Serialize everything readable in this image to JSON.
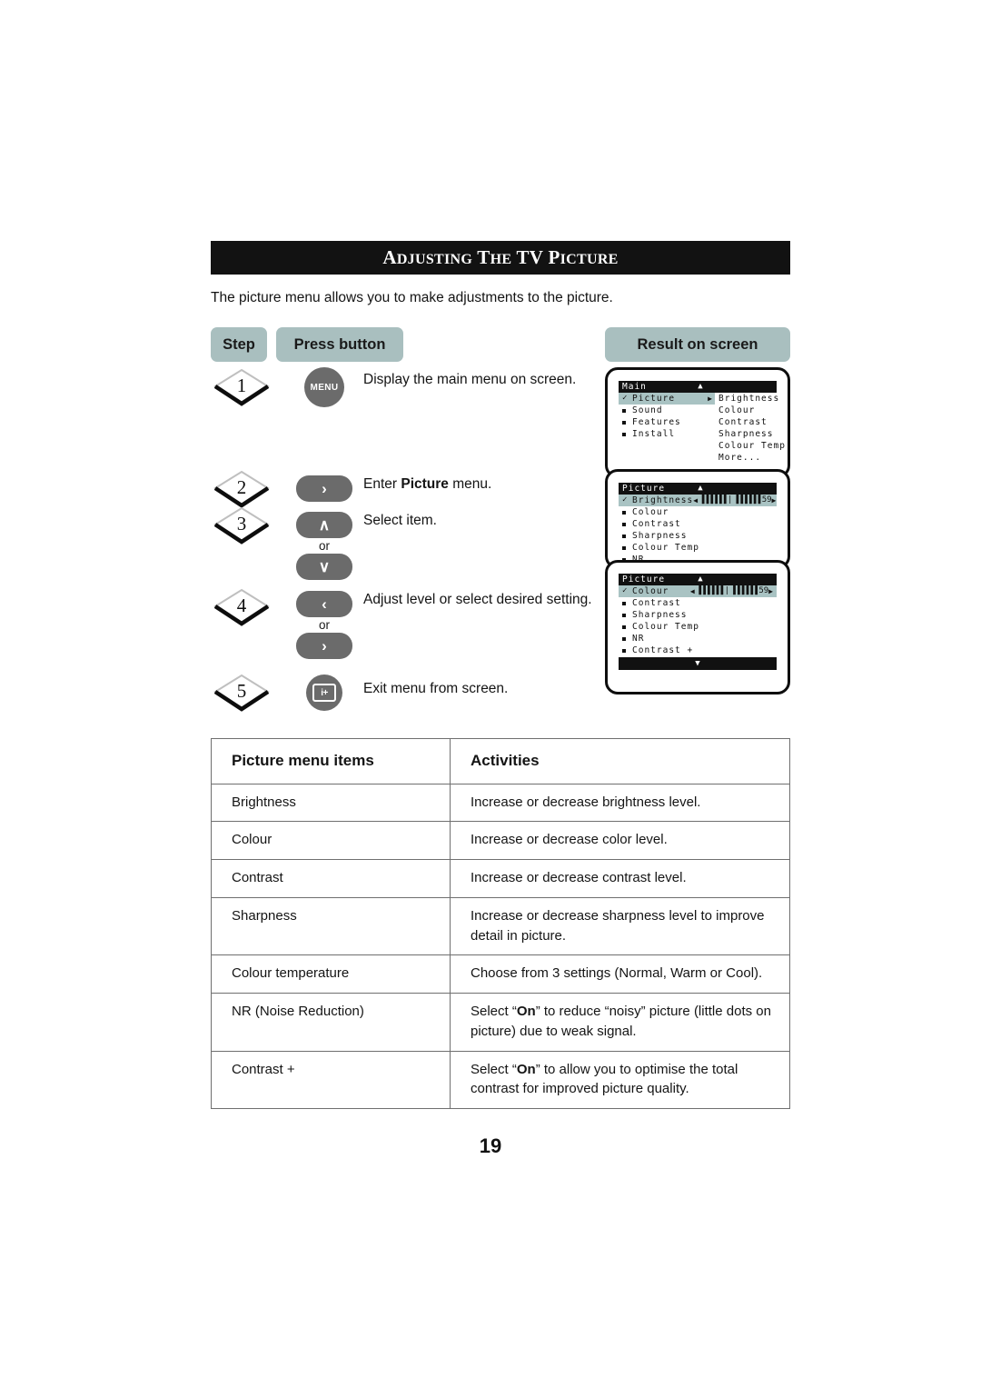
{
  "header": {
    "title_small_1": "A",
    "title": "ADJUSTING THE TV PICTURE",
    "intro": "The picture menu allows you to make adjustments to the picture."
  },
  "column_headers": {
    "step": "Step",
    "press_button": "Press button",
    "result": "Result on screen"
  },
  "steps": [
    {
      "number": "1",
      "button_kind": "circle",
      "button_label": "MENU",
      "description": "Display the main menu on screen."
    },
    {
      "number": "2",
      "button_kind": "pill",
      "button_label": "›",
      "description_prefix": "Enter ",
      "description_bold": "Picture",
      "description_suffix": " menu."
    },
    {
      "number": "3",
      "button_kind": "pill-pair",
      "button_label_top": "∧",
      "or_label": "or",
      "button_label_bottom": "∨",
      "description": "Select item."
    },
    {
      "number": "4",
      "button_kind": "pill-pair",
      "button_label_top": "‹",
      "or_label": "or",
      "button_label_bottom": "›",
      "description": "Adjust level or select desired setting."
    },
    {
      "number": "5",
      "button_kind": "circle-info",
      "button_label": "i+",
      "description": "Exit menu from screen."
    }
  ],
  "screens": [
    {
      "name": "main-menu",
      "title": "Main",
      "up_arrow": "▲",
      "left_items": [
        {
          "label": "Picture",
          "selected": true,
          "has_right_arrow": true
        },
        {
          "label": "Sound",
          "selected": false
        },
        {
          "label": "Features",
          "selected": false
        },
        {
          "label": "Install",
          "selected": false
        }
      ],
      "right_items": [
        "Brightness",
        "Colour",
        "Contrast",
        "Sharpness",
        "Colour Temp",
        "More..."
      ]
    },
    {
      "name": "picture-menu-brightness",
      "title": "Picture",
      "up_arrow": "▲",
      "items": [
        {
          "label": "Brightness",
          "selected": true,
          "slider": {
            "value": "59",
            "left_arrow": "◀",
            "right_arrow": "▶",
            "ticks_left": "▐▐▐▐▐▐",
            "center": "|",
            "ticks_right": "▐▐▐▐▐▐"
          }
        },
        {
          "label": "Colour",
          "selected": false
        },
        {
          "label": "Contrast",
          "selected": false
        },
        {
          "label": "Sharpness",
          "selected": false
        },
        {
          "label": "Colour Temp",
          "selected": false
        },
        {
          "label": "NR",
          "selected": false
        }
      ]
    },
    {
      "name": "picture-menu-colour",
      "title": "Picture",
      "up_arrow": "▲",
      "items": [
        {
          "label": "Colour",
          "selected": true,
          "slider": {
            "value": "59",
            "left_arrow": "◀",
            "right_arrow": "▶",
            "ticks_left": "▐▐▐▐▐▐",
            "center": "|",
            "ticks_right": "▐▐▐▐▐▐"
          }
        },
        {
          "label": "Contrast",
          "selected": false
        },
        {
          "label": "Sharpness",
          "selected": false
        },
        {
          "label": "Colour Temp",
          "selected": false
        },
        {
          "label": "NR",
          "selected": false
        },
        {
          "label": "Contrast +",
          "selected": false
        }
      ],
      "footer_arrow": "▼"
    }
  ],
  "table": {
    "headers": [
      "Picture menu items",
      "Activities"
    ],
    "rows": [
      {
        "item": "Brightness",
        "activity": "Increase or decrease brightness level."
      },
      {
        "item": "Colour",
        "activity": "Increase or decrease color level."
      },
      {
        "item": "Contrast",
        "activity": "Increase or decrease contrast level."
      },
      {
        "item": "Sharpness",
        "activity": "Increase or decrease sharpness level to improve detail in picture."
      },
      {
        "item": "Colour temperature",
        "activity": "Choose from 3 settings (Normal, Warm or Cool)."
      },
      {
        "item": "NR (Noise Reduction)",
        "activity_pre": "Select “",
        "activity_bold": "On",
        "activity_post": "” to reduce “noisy” picture (little dots on picture) due to weak signal."
      },
      {
        "item": "Contrast +",
        "activity_pre": "Select “",
        "activity_bold": "On",
        "activity_post": "” to allow you to optimise the total contrast for improved picture quality."
      }
    ]
  },
  "footer": {
    "page_number": "19"
  },
  "colors": {
    "pill": "#a9bfbf",
    "title_bar": "#121212",
    "button_gray": "#6b6b6b",
    "osd_highlight": "#a9c3c3"
  }
}
